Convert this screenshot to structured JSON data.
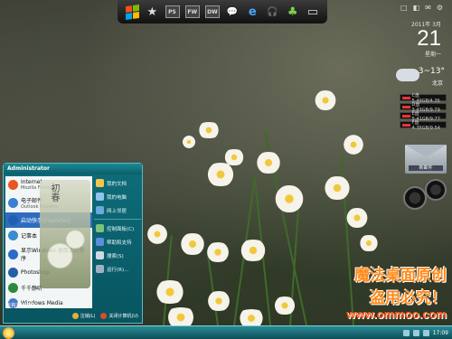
{
  "dock": {
    "items": [
      {
        "name": "windows-logo-icon"
      },
      {
        "name": "star-icon",
        "glyph": "★"
      },
      {
        "name": "photoshop-icon",
        "label": "PS"
      },
      {
        "name": "fireworks-icon",
        "label": "FW"
      },
      {
        "name": "dreamweaver-icon",
        "label": "DW"
      },
      {
        "name": "chat-icon",
        "glyph": "💬"
      },
      {
        "name": "ie-icon",
        "glyph": "e"
      },
      {
        "name": "headphones-icon",
        "glyph": "🎧"
      },
      {
        "name": "frog-icon",
        "glyph": "♣"
      },
      {
        "name": "bag-icon",
        "glyph": "▭"
      }
    ]
  },
  "gadgets": {
    "clock": {
      "year_month": "2011年 3月",
      "day": "21",
      "weekday": "星期一"
    },
    "weather": {
      "temp": "3~13°",
      "city": "北京"
    },
    "meters": [
      "C盘 5.49GB/4.35",
      "D盘 3.43GB/9.79",
      "E盘 5.41GB/9.77",
      "F盘 4.35GB/9.54"
    ],
    "mail_label": "新邮件",
    "topright": [
      "□",
      "◧",
      "✉",
      "⚙"
    ]
  },
  "start_menu": {
    "user": "Administrator",
    "programs": [
      {
        "title": "Internet",
        "sub": "Mozilla Firefox",
        "color": "#e8571e"
      },
      {
        "title": "电子邮件",
        "sub": "Outlook Express",
        "color": "#3b7fd1"
      },
      {
        "title": "启动快手(FlashGet)",
        "sub": "",
        "color": "#1f5fb2",
        "selected": true
      },
      {
        "title": "记事本",
        "sub": "",
        "color": "#3a8bcf"
      },
      {
        "title": "显示Windows 桌面上的程序",
        "sub": "",
        "color": "#2a6cc7"
      },
      {
        "title": "Photoshop",
        "sub": "",
        "color": "#2460a8"
      },
      {
        "title": "千千静听",
        "sub": "",
        "color": "#2b8a3e"
      },
      {
        "title": "Windows Media",
        "sub": "",
        "color": "#4a78c8"
      }
    ],
    "all_programs": "所有程序(P)",
    "right_items": [
      "我的文档",
      "我的电脑",
      "网上邻居",
      "控制面板(C)",
      "帮助和支持",
      "搜索(S)",
      "运行(R)..."
    ],
    "art_text": "初春",
    "footer": {
      "logoff": "注销(L)",
      "shutdown": "关闭计算机(U)"
    }
  },
  "watermark": {
    "line1": "魔法桌面原创",
    "line2": "盗用必究！",
    "line3": "www.ommoo.com"
  },
  "taskbar": {
    "time": "17:09"
  }
}
